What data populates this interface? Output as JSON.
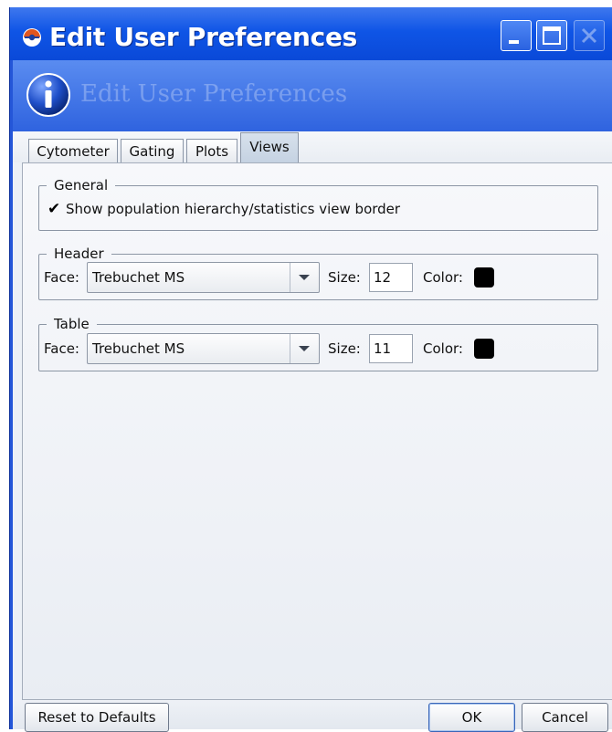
{
  "window": {
    "title": "Edit User Preferences",
    "header_text": "Edit User Preferences"
  },
  "tabs": [
    {
      "label": "Cytometer"
    },
    {
      "label": "Gating"
    },
    {
      "label": "Plots"
    },
    {
      "label": "Views",
      "active": true
    }
  ],
  "general": {
    "legend": "General",
    "show_border_label": "Show population hierarchy/statistics view border",
    "show_border_checked": true
  },
  "header_group": {
    "legend": "Header",
    "face_label": "Face:",
    "face_value": "Trebuchet MS",
    "size_label": "Size:",
    "size_value": "12",
    "color_label": "Color:",
    "color_value": "#000000"
  },
  "table_group": {
    "legend": "Table",
    "face_label": "Face:",
    "face_value": "Trebuchet MS",
    "size_label": "Size:",
    "size_value": "11",
    "color_label": "Color:",
    "color_value": "#000000"
  },
  "buttons": {
    "reset": "Reset to Defaults",
    "ok": "OK",
    "cancel": "Cancel"
  },
  "colors": {
    "titlebar": "#0f55e6",
    "client_bg": "#ecf0f6"
  }
}
